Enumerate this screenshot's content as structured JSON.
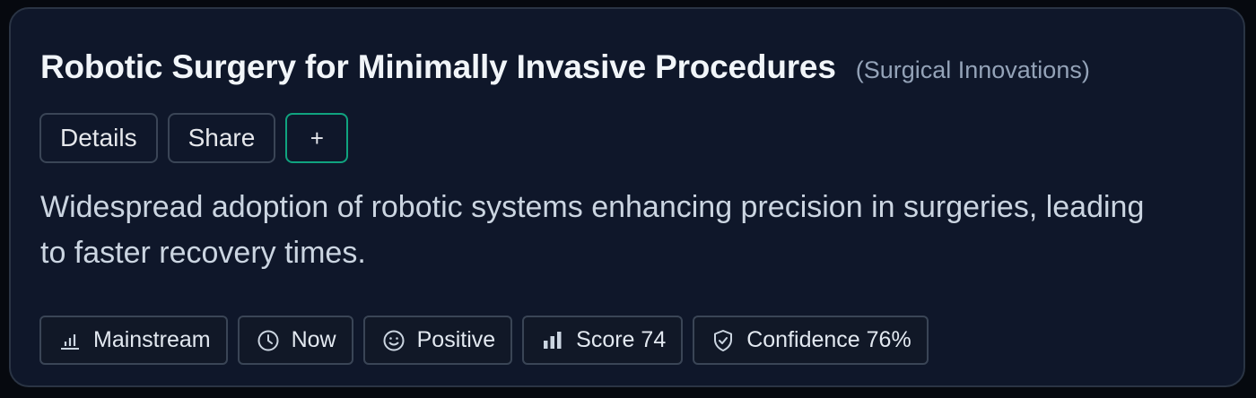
{
  "card": {
    "title": "Robotic Surgery for Minimally Invasive Procedures",
    "category": "(Surgical Innovations)",
    "description": "Widespread adoption of robotic systems enhancing precision in surgeries, leading to faster recovery times."
  },
  "actions": {
    "details_label": "Details",
    "share_label": "Share",
    "add_label": "+"
  },
  "chips": [
    {
      "icon": "bar-chart-icon",
      "label": "Mainstream"
    },
    {
      "icon": "clock-icon",
      "label": "Now"
    },
    {
      "icon": "smiley-icon",
      "label": "Positive"
    },
    {
      "icon": "signal-bars-icon",
      "label": "Score 74"
    },
    {
      "icon": "shield-check-icon",
      "label": "Confidence 76%"
    }
  ],
  "colors": {
    "background": "#0f172a",
    "border": "#2a3444",
    "accent": "#10a37f",
    "title": "#f1f5f9",
    "muted": "#94a3b8"
  }
}
